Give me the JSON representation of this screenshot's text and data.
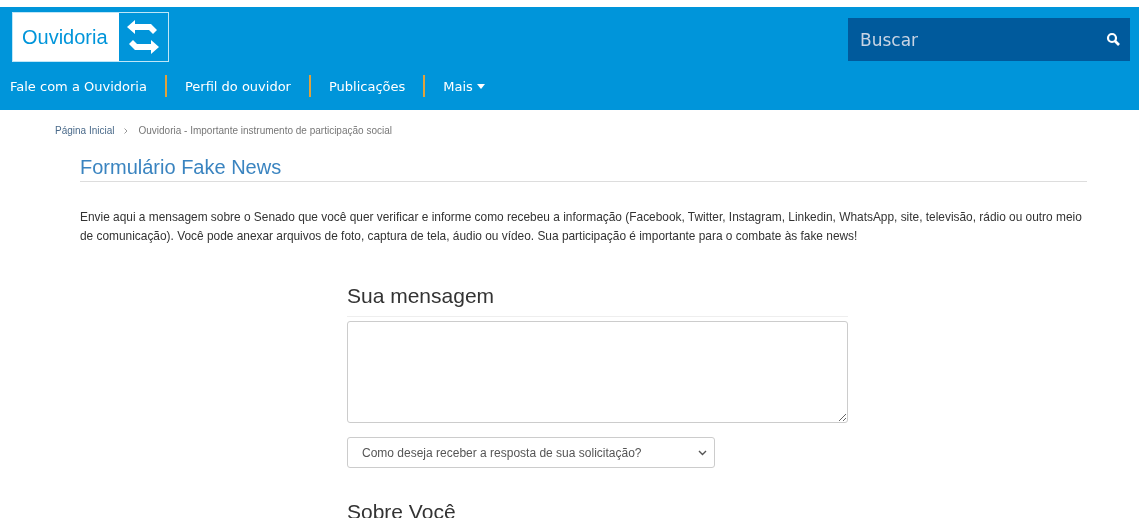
{
  "header": {
    "logo": "Ouvidoria",
    "search": {
      "placeholder": "Buscar"
    }
  },
  "nav": [
    {
      "label": "Fale com a Ouvidoria",
      "kind": "link"
    },
    {
      "label": "Perfil do ouvidor",
      "kind": "link"
    },
    {
      "label": "Publicações",
      "kind": "link"
    },
    {
      "label": "Mais",
      "kind": "dropdown"
    }
  ],
  "breadcrumb": [
    "Página Inicial",
    "Ouvidoria - Importante instrumento de participação social"
  ],
  "page_title": "Formulário Fake News",
  "intro": "Envie aqui a mensagem sobre o Senado que você quer verificar e informe como recebeu a informação (Facebook, Twitter, Instagram, Linkedin, WhatsApp, site, televisão, rádio ou outro meio de comunicação). Você pode anexar arquivos de foto, captura de tela, áudio ou vídeo. Sua participação é importante para o combate às fake news!",
  "form": {
    "message_heading": "Sua mensagem",
    "response_select": "Como deseja receber a resposta de sua solicitação?",
    "about_heading": "Sobre Você"
  }
}
